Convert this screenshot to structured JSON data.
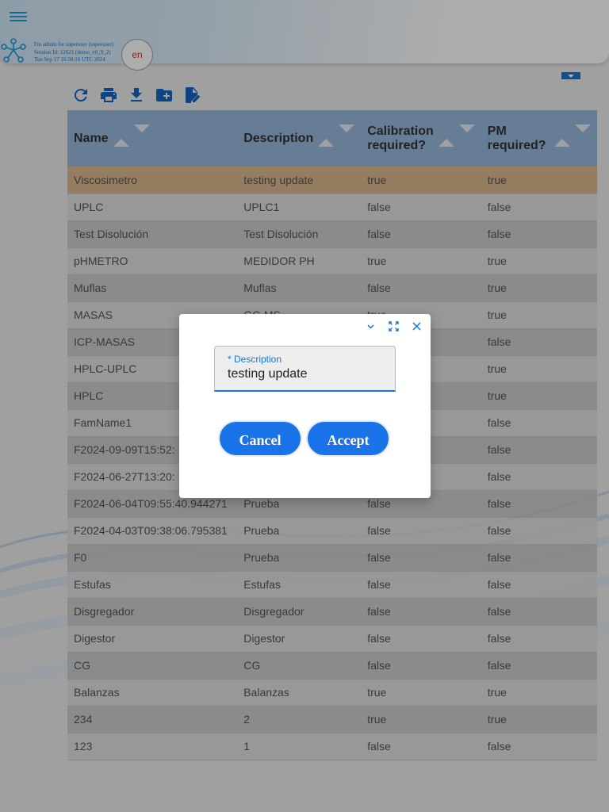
{
  "header": {
    "session_lines": [
      "I'm admin for superuser (superuser)",
      "Session Id: 12621 (demo_v0_9_2)",
      "Tue Sep 17 16:50:16 UTC 2024"
    ],
    "language": "en",
    "accent_color": "#1f9ad6"
  },
  "toolbar": {
    "icons": [
      "refresh-icon",
      "print-icon",
      "download-icon",
      "new-folder-icon",
      "edit-document-icon"
    ]
  },
  "table": {
    "columns": [
      "Name",
      "Description",
      "Calibration required?",
      "PM required?"
    ],
    "rows": [
      [
        "Viscosimetro",
        "testing update",
        "true",
        "true"
      ],
      [
        "UPLC",
        "UPLC1",
        "false",
        "false"
      ],
      [
        "Test Disolución",
        "Test Disolución",
        "false",
        "false"
      ],
      [
        "pHMETRO",
        "MEDIDOR PH",
        "true",
        "true"
      ],
      [
        "Muflas",
        "Muflas",
        "false",
        "true"
      ],
      [
        "MASAS",
        "GC-MS",
        "true",
        "true"
      ],
      [
        "ICP-MASAS",
        "",
        "",
        "false"
      ],
      [
        "HPLC-UPLC",
        "",
        "",
        "true"
      ],
      [
        "HPLC",
        "",
        "",
        "true"
      ],
      [
        "FamName1",
        "",
        "",
        "false"
      ],
      [
        "F2024-09-09T15:52:",
        "",
        "",
        "false"
      ],
      [
        "F2024-06-27T13:20:",
        "",
        "",
        "false"
      ],
      [
        "F2024-06-04T09:55:40.944271",
        "Prueba",
        "false",
        "false"
      ],
      [
        "F2024-04-03T09:38:06.795381",
        "Prueba",
        "false",
        "false"
      ],
      [
        "F0",
        "Prueba",
        "false",
        "false"
      ],
      [
        "Estufas",
        "Estufas",
        "false",
        "false"
      ],
      [
        "Disgregador",
        "Disgregador",
        "false",
        "false"
      ],
      [
        "Digestor",
        "Digestor",
        "false",
        "false"
      ],
      [
        "CG",
        "CG",
        "false",
        "false"
      ],
      [
        "Balanzas",
        "Balanzas",
        "true",
        "true"
      ],
      [
        "234",
        "2",
        "true",
        "true"
      ],
      [
        "123",
        "1",
        "false",
        "false"
      ]
    ],
    "selected_row": 0,
    "selected_color": "#dcb88f",
    "header_color": "#98b9de"
  },
  "dialog": {
    "field_label": "* Description",
    "field_value": "testing update",
    "cancel_label": "Cancel",
    "accept_label": "Accept",
    "button_color": "#1a73e8"
  }
}
